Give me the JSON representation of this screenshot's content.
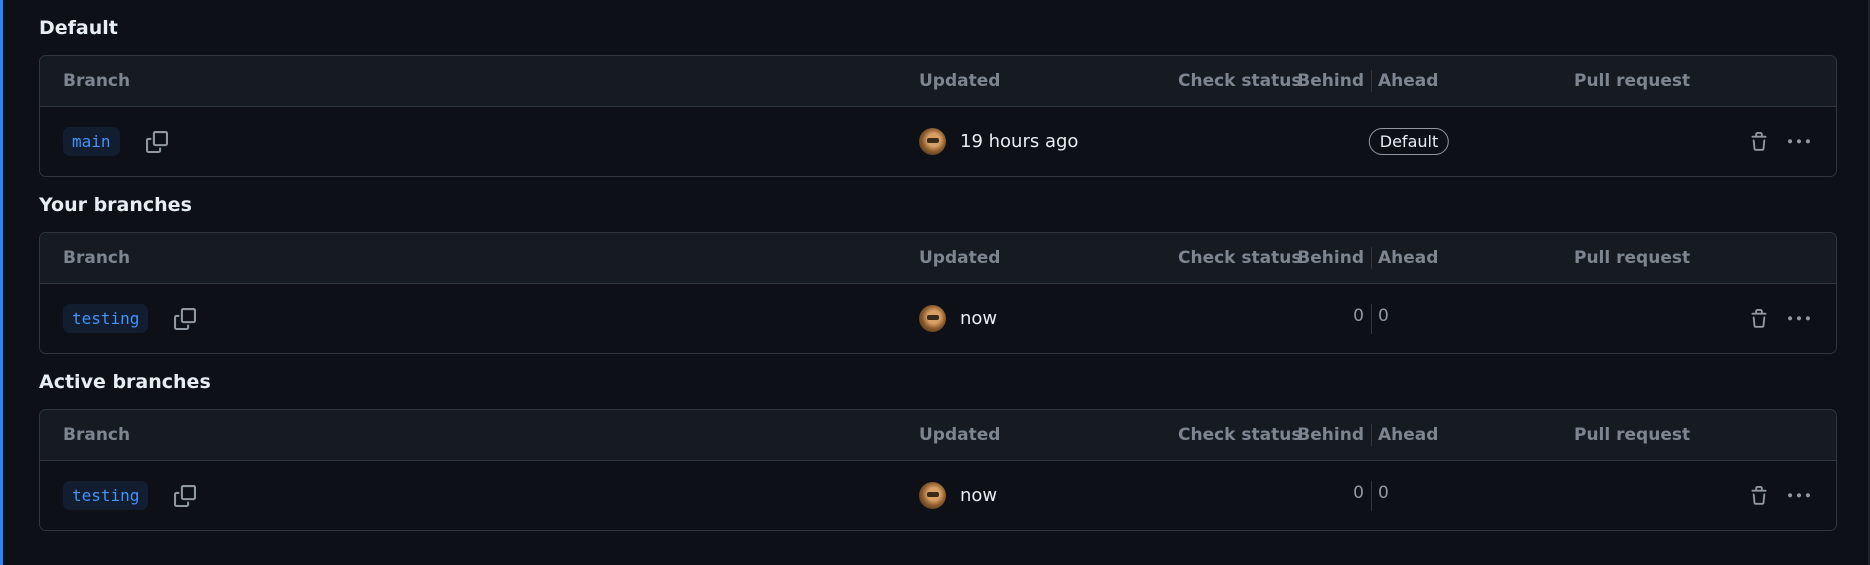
{
  "colors": {
    "background": "#0d1117",
    "header_bg": "#161b22",
    "border": "#30363d",
    "accent": "#2f81f7",
    "branch_text": "#4493f8",
    "muted": "#7d8590"
  },
  "columns": {
    "branch": "Branch",
    "updated": "Updated",
    "check_status": "Check status",
    "behind": "Behind",
    "ahead": "Ahead",
    "pull_request": "Pull request"
  },
  "sections": [
    {
      "title": "Default",
      "row": {
        "branch": "main",
        "updated": "19 hours ago",
        "badge": "Default"
      }
    },
    {
      "title": "Your branches",
      "row": {
        "branch": "testing",
        "updated": "now",
        "behind": "0",
        "ahead": "0"
      }
    },
    {
      "title": "Active branches",
      "row": {
        "branch": "testing",
        "updated": "now",
        "behind": "0",
        "ahead": "0"
      }
    }
  ],
  "icons": {
    "copy": "copy-icon",
    "delete": "trash-icon",
    "more": "kebab-horizontal-icon",
    "avatar": "user-avatar"
  }
}
